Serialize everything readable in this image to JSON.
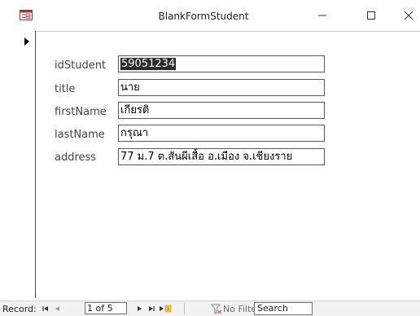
{
  "window": {
    "title": "BlankFormStudent",
    "controls": {
      "minimize_glyph": "—",
      "maximize_glyph": "☐",
      "close_glyph": "✕"
    }
  },
  "form": {
    "fields": [
      {
        "label": "idStudent",
        "value": "59051234",
        "selected": true
      },
      {
        "label": "title",
        "value": "นาย"
      },
      {
        "label": "firstName",
        "value": "เกียรติ"
      },
      {
        "label": "lastName",
        "value": "กรุณา"
      },
      {
        "label": "address",
        "value": "77 ม.7 ต.สันผีเสื้อ อ.เมือง จ.เชียงราย"
      }
    ]
  },
  "navigation": {
    "record_label": "Record:",
    "current": "1 of 5",
    "filter_label": "No Filter",
    "search_label": "Search"
  },
  "icons": {
    "app": "access-form-icon",
    "filter": "no-filter-icon"
  }
}
